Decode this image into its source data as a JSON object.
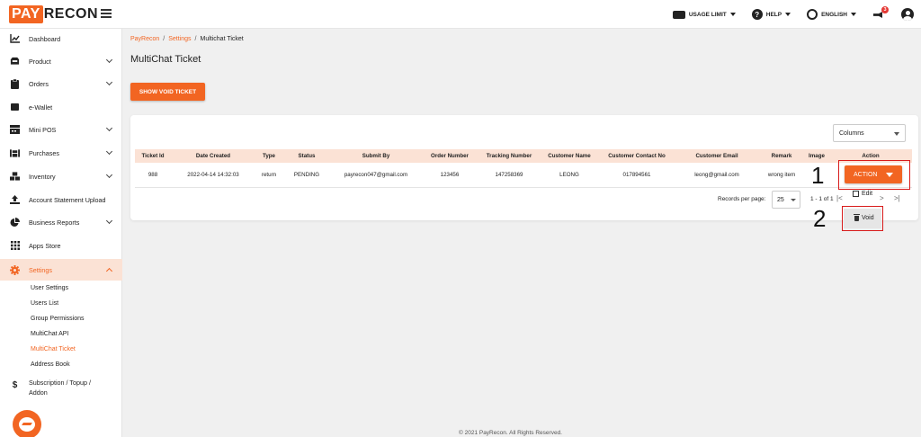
{
  "brand": {
    "pay": "PAY",
    "recon": "RECON"
  },
  "topnav": {
    "usage_limit": "USAGE LIMIT",
    "help": "HELP",
    "language": "ENGLISH",
    "notification_count": "3"
  },
  "sidebar": {
    "items": [
      {
        "label": "Dashboard",
        "icon": "chart-line-icon"
      },
      {
        "label": "Product",
        "icon": "box-icon"
      },
      {
        "label": "Orders",
        "icon": "clipboard-icon"
      },
      {
        "label": "e-Wallet",
        "icon": "wallet-icon"
      },
      {
        "label": "Mini POS",
        "icon": "pos-icon"
      },
      {
        "label": "Purchases",
        "icon": "warehouse-icon"
      },
      {
        "label": "Inventory",
        "icon": "boxes-icon"
      },
      {
        "label": "Account Statement Upload",
        "icon": "upload-icon"
      },
      {
        "label": "Business Reports",
        "icon": "pie-chart-icon"
      },
      {
        "label": "Apps Store",
        "icon": "grid-icon"
      },
      {
        "label": "Settings",
        "icon": "gear-icon"
      }
    ],
    "settings_sub": [
      "User Settings",
      "Users List",
      "Group Permissions",
      "MultiChat API",
      "MultiChat Ticket",
      "Address Book"
    ],
    "subscription": {
      "line1": "Subscription / Topup /",
      "line2": "Addon"
    }
  },
  "breadcrumb": {
    "home": "PayRecon",
    "settings": "Settings",
    "current": "Multichat Ticket"
  },
  "page_title": "MultiChat Ticket",
  "show_void_label": "SHOW VOID TICKET",
  "columns_label": "Columns",
  "table": {
    "headers": [
      "Ticket Id",
      "Date Created",
      "Type",
      "Status",
      "Submit By",
      "Order Number",
      "Tracking Number",
      "Customer Name",
      "Customer Contact No",
      "Customer Email",
      "Remark",
      "Image",
      "Action"
    ],
    "rows": [
      [
        "988",
        "2022-04-14 14:32:03",
        "return",
        "PENDING",
        "payrecon047@gmail.com",
        "123456",
        "147258369",
        "LEONG",
        "017894561",
        "leong@gmail.com",
        "wrong item",
        ""
      ]
    ]
  },
  "action_label": "ACTION",
  "action_menu": {
    "edit": "Edit",
    "void": "Void"
  },
  "pagination": {
    "records_label": "Records per page:",
    "per_page": "25",
    "range": "1 - 1 of 1"
  },
  "markers": {
    "one": "1",
    "two": "2"
  },
  "footer": "© 2021 PayRecon. All Rights Reserved.",
  "colors": {
    "accent": "#f26522",
    "header_bg": "#fbe2d5",
    "highlight": "#d81b1b"
  }
}
